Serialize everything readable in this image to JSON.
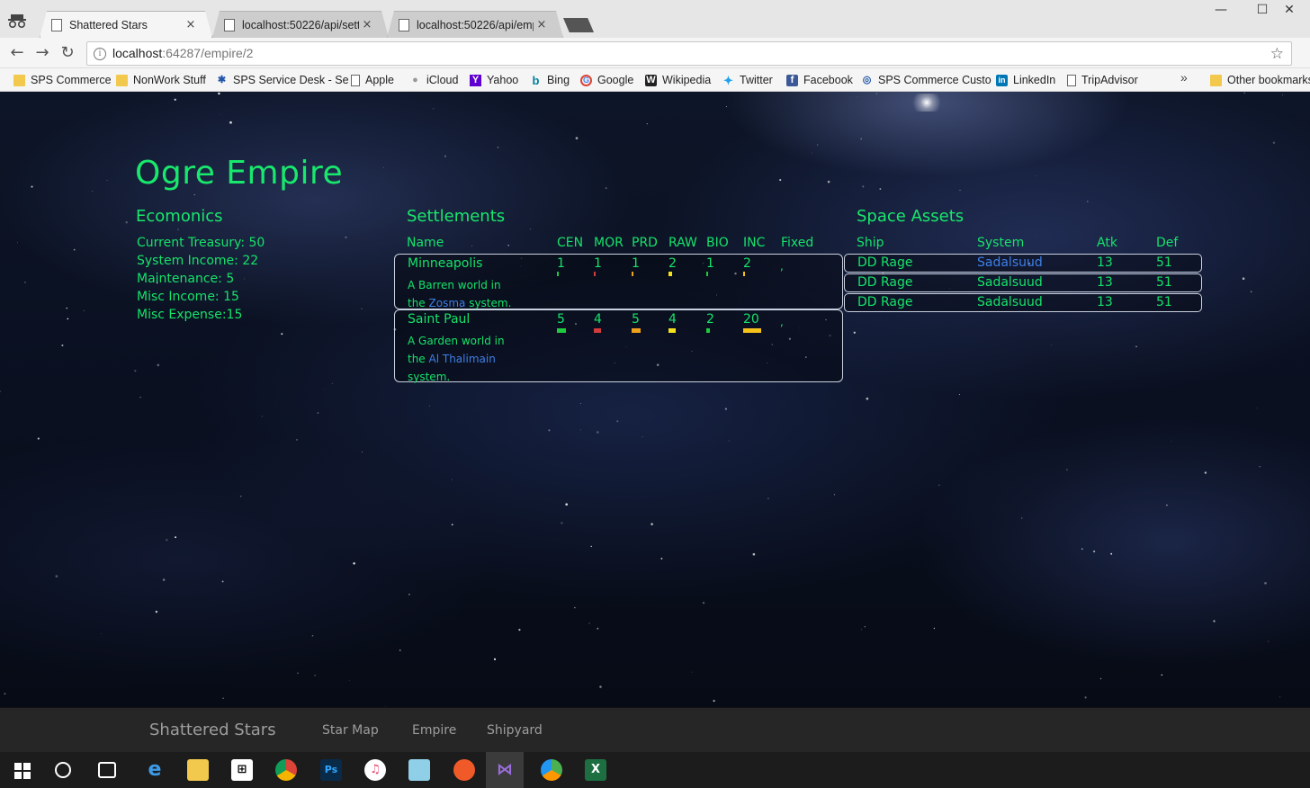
{
  "browser": {
    "tabs": [
      {
        "title": "Shattered Stars",
        "active": true
      },
      {
        "title": "localhost:50226/api/settl",
        "active": false
      },
      {
        "title": "localhost:50226/api/emp",
        "active": false
      }
    ],
    "close_glyph": "×",
    "url_host": "localhost",
    "url_rest": ":64287/empire/2",
    "bookmarks": [
      {
        "label": "SPS Commerce",
        "icon": "folder-icon"
      },
      {
        "label": "NonWork Stuff",
        "icon": "folder-icon"
      },
      {
        "label": "SPS Service Desk - Se",
        "icon": "sps-icon"
      },
      {
        "label": "Apple",
        "icon": "page-icon"
      },
      {
        "label": "iCloud",
        "icon": "apple-icon"
      },
      {
        "label": "Yahoo",
        "icon": "yahoo-icon"
      },
      {
        "label": "Bing",
        "icon": "bing-icon"
      },
      {
        "label": "Google",
        "icon": "google-icon"
      },
      {
        "label": "Wikipedia",
        "icon": "wikipedia-icon"
      },
      {
        "label": "Twitter",
        "icon": "twitter-icon"
      },
      {
        "label": "Facebook",
        "icon": "facebook-icon"
      },
      {
        "label": "SPS Commerce Custo",
        "icon": "sps-icon"
      },
      {
        "label": "LinkedIn",
        "icon": "linkedin-icon"
      },
      {
        "label": "TripAdvisor",
        "icon": "page-icon"
      }
    ],
    "more_glyph": "»",
    "other_bookmarks": "Other bookmarks"
  },
  "empire": {
    "title": "Ogre Empire"
  },
  "economics": {
    "heading": "Ecomonics",
    "lines": [
      "Current Treasury: 50",
      "System Income: 22",
      "Maintenance: 5",
      "Misc Income: 15",
      "Misc Expense:15"
    ]
  },
  "settlements": {
    "heading": "Settlements",
    "columns": [
      "Name",
      "CEN",
      "MOR",
      "PRD",
      "RAW",
      "BIO",
      "INC",
      "Fixed"
    ],
    "rows": [
      {
        "name": "Minneapolis",
        "desc_pre": "A Barren world in the ",
        "system": "Zosma",
        "desc_post": " system.",
        "stats": [
          "1",
          "1",
          "1",
          "2",
          "1",
          "2"
        ],
        "fixed": ","
      },
      {
        "name": "Saint Paul",
        "desc_pre": "A Garden world in the ",
        "system": "Al Thalimain",
        "desc_post": " system.",
        "stats": [
          "5",
          "4",
          "5",
          "4",
          "2",
          "20"
        ],
        "fixed": ","
      }
    ],
    "stat_colors": [
      "#1ecb3c",
      "#d23b3b",
      "#f0a11c",
      "#f6e21a",
      "#1ecb3c",
      "#f6c21a"
    ]
  },
  "space_assets": {
    "heading": "Space Assets",
    "columns": [
      "Ship",
      "System",
      "Atk",
      "Def"
    ],
    "rows": [
      {
        "ship": "DD Rage",
        "system": "Sadalsuud",
        "atk": "13",
        "def": "51"
      },
      {
        "ship": "DD Rage",
        "system": "Sadalsuud",
        "atk": "13",
        "def": "51"
      },
      {
        "ship": "DD Rage",
        "system": "Sadalsuud",
        "atk": "13",
        "def": "51"
      }
    ]
  },
  "navbar": {
    "brand": "Shattered Stars",
    "links": [
      "Star Map",
      "Empire",
      "Shipyard"
    ]
  }
}
